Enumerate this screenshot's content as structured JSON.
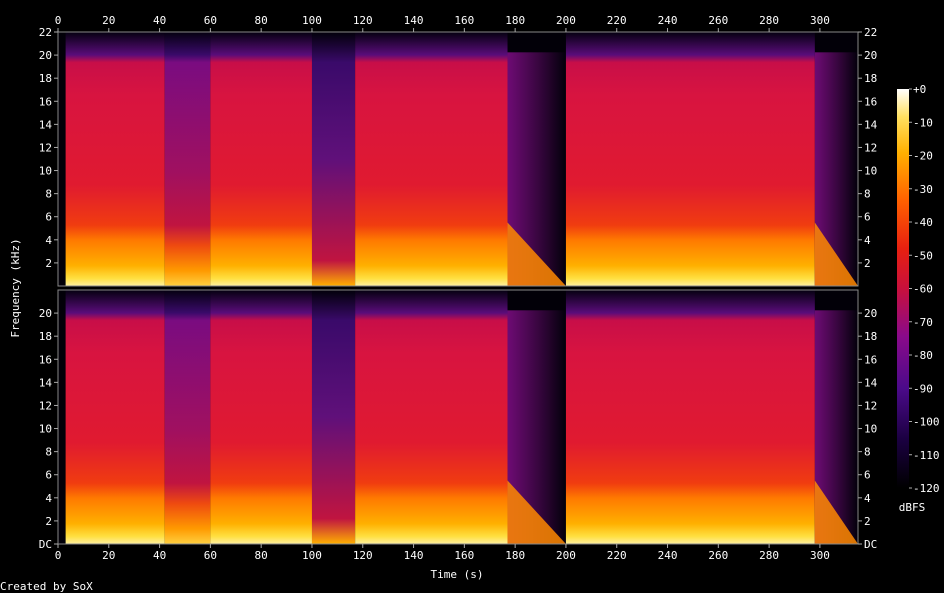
{
  "chart_data": {
    "type": "heatmap",
    "subtype": "spectrogram",
    "channels": 2,
    "xlabel": "Time (s)",
    "ylabel": "Frequency (kHz)",
    "x_ticks": [
      "0",
      "20",
      "40",
      "60",
      "80",
      "100",
      "120",
      "140",
      "160",
      "180",
      "200",
      "220",
      "240",
      "260",
      "280",
      "300"
    ],
    "xlim": [
      0,
      315
    ],
    "y_ticks_top_channel": [
      "2",
      "4",
      "6",
      "8",
      "10",
      "12",
      "14",
      "16",
      "18",
      "20",
      "22"
    ],
    "y_ticks_bottom_channel": [
      "DC",
      "2",
      "4",
      "6",
      "8",
      "10",
      "12",
      "14",
      "16",
      "18",
      "20"
    ],
    "ylim_khz": [
      0,
      22
    ],
    "colorbar": {
      "label": "dBFS",
      "ticks": [
        "+0",
        "-10",
        "-20",
        "-30",
        "-40",
        "-50",
        "-60",
        "-70",
        "-80",
        "-90",
        "-100",
        "-110",
        "-120"
      ],
      "range": [
        -120,
        0
      ],
      "colors": [
        "#000000",
        "#1a0040",
        "#4b0a8a",
        "#8a0a8a",
        "#c8103c",
        "#e82010",
        "#ff6000",
        "#ffb000",
        "#ffe060",
        "#ffffff"
      ]
    },
    "segments": [
      {
        "start": 3,
        "end": 42,
        "level": "loud"
      },
      {
        "start": 42,
        "end": 60,
        "level": "moderate"
      },
      {
        "start": 60,
        "end": 100,
        "level": "loud"
      },
      {
        "start": 100,
        "end": 117,
        "level": "sparse"
      },
      {
        "start": 117,
        "end": 177,
        "level": "loud"
      },
      {
        "start": 177,
        "end": 200,
        "level": "fade"
      },
      {
        "start": 200,
        "end": 298,
        "level": "loud"
      },
      {
        "start": 298,
        "end": 315,
        "level": "fade"
      }
    ],
    "footer": "Created by SoX"
  }
}
